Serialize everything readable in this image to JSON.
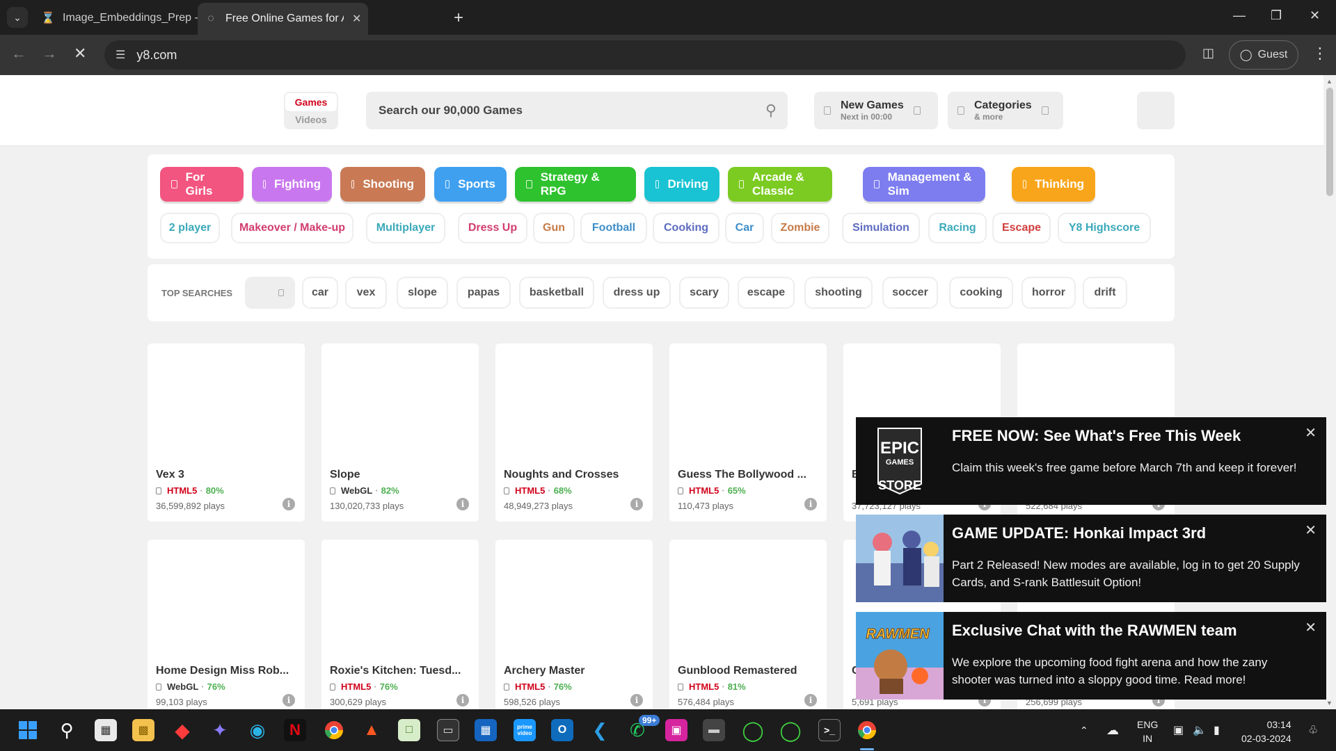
{
  "browser": {
    "tabs": [
      {
        "label": "Image_Embeddings_Prep - Jupyter",
        "icon": "hourglass-icon",
        "active": false
      },
      {
        "label": "Free Online Games for All Ages",
        "icon": "loading-icon",
        "active": true
      }
    ],
    "url": "y8.com",
    "profile_label": "Guest"
  },
  "header": {
    "toggle_games": "Games",
    "toggle_videos": "Videos",
    "search_placeholder": "Search our 90,000 Games",
    "new_games_title": "New Games",
    "new_games_sub": "Next in 00:00",
    "categories_title": "Categories",
    "categories_sub": "& more"
  },
  "main_categories": [
    {
      "label": "For Girls",
      "color": "#f2557f"
    },
    {
      "label": "Fighting",
      "color": "#c977ef"
    },
    {
      "label": "Shooting",
      "color": "#c97a55"
    },
    {
      "label": "Sports",
      "color": "#3fa0f0"
    },
    {
      "label": "Strategy & RPG",
      "color": "#2ec22e"
    },
    {
      "label": "Driving",
      "color": "#19c3d3"
    },
    {
      "label": "Arcade & Classic",
      "color": "#7ccb22"
    },
    {
      "label": "Management & Sim",
      "color": "#7d7df0"
    },
    {
      "label": "Thinking",
      "color": "#f9a51b"
    }
  ],
  "tag_categories": [
    {
      "label": "2 player",
      "color": "#3aa9b9"
    },
    {
      "label": "Makeover / Make-up",
      "color": "#d13d6e"
    },
    {
      "label": "Multiplayer",
      "color": "#3aa9b9"
    },
    {
      "label": "Dress Up",
      "color": "#d13d6e"
    },
    {
      "label": "Gun",
      "color": "#c67a48"
    },
    {
      "label": "Football",
      "color": "#3e8ec9"
    },
    {
      "label": "Cooking",
      "color": "#5c6bc0"
    },
    {
      "label": "Car",
      "color": "#3e8ec9"
    },
    {
      "label": "Zombie",
      "color": "#c67a48"
    },
    {
      "label": "Simulation",
      "color": "#5c6bc0"
    },
    {
      "label": "Racing",
      "color": "#3aa9b9"
    },
    {
      "label": "Escape",
      "color": "#d13d3d"
    },
    {
      "label": "Y8 Highscore",
      "color": "#3aa9b9"
    }
  ],
  "top_searches": {
    "label": "TOP SEARCHES",
    "items": [
      "car",
      "vex",
      "slope",
      "papas",
      "basketball",
      "dress up",
      "scary",
      "escape",
      "shooting",
      "soccer",
      "cooking",
      "horror",
      "drift"
    ]
  },
  "games": [
    {
      "title": "Vex 3",
      "tech": "HTML5",
      "rating": "80%",
      "plays": "36,599,892 plays"
    },
    {
      "title": "Slope",
      "tech": "WebGL",
      "rating": "82%",
      "plays": "130,020,733 plays"
    },
    {
      "title": "Noughts and Crosses",
      "tech": "HTML5",
      "rating": "68%",
      "plays": "48,949,273 plays"
    },
    {
      "title": "Guess The Bollywood ...",
      "tech": "HTML5",
      "rating": "65%",
      "plays": "110,473 plays"
    },
    {
      "title": "B",
      "tech": "",
      "rating": "",
      "plays": "37,723,127 plays"
    },
    {
      "title": "",
      "tech": "",
      "rating": "",
      "plays": "522,684 plays"
    },
    {
      "title": "Home Design Miss Rob...",
      "tech": "WebGL",
      "rating": "76%",
      "plays": "99,103 plays"
    },
    {
      "title": "Roxie's Kitchen: Tuesd...",
      "tech": "HTML5",
      "rating": "76%",
      "plays": "300,629 plays"
    },
    {
      "title": "Archery Master",
      "tech": "HTML5",
      "rating": "76%",
      "plays": "598,526 plays"
    },
    {
      "title": "Gunblood Remastered",
      "tech": "HTML5",
      "rating": "81%",
      "plays": "576,484 plays"
    },
    {
      "title": "C",
      "tech": "",
      "rating": "",
      "plays": "5,691 plays"
    },
    {
      "title": "",
      "tech": "",
      "rating": "",
      "plays": "256,699 plays"
    }
  ],
  "notifications": [
    {
      "title": "FREE NOW: See What's Free This Week",
      "body": "Claim this week's free game before March 7th and keep it forever!",
      "logo_line1": "EPIC",
      "logo_line2": "GAMES",
      "logo_line3": "STORE"
    },
    {
      "title": "GAME UPDATE: Honkai Impact 3rd",
      "body": "Part 2 Released! New modes are available, log in to get 20 Supply Cards, and S-rank Battlesuit Option!"
    },
    {
      "title": "Exclusive Chat with the RAWMEN team",
      "body": "We explore the upcoming food fight arena and how the zany shooter was turned into a sloppy good time. Read more!",
      "logo_text": "RAWMEN"
    }
  ],
  "taskbar": {
    "whatsapp_badge": "99+",
    "prime_label": "prime video",
    "lang_line1": "ENG",
    "lang_line2": "IN",
    "time": "03:14",
    "date": "02-03-2024"
  }
}
